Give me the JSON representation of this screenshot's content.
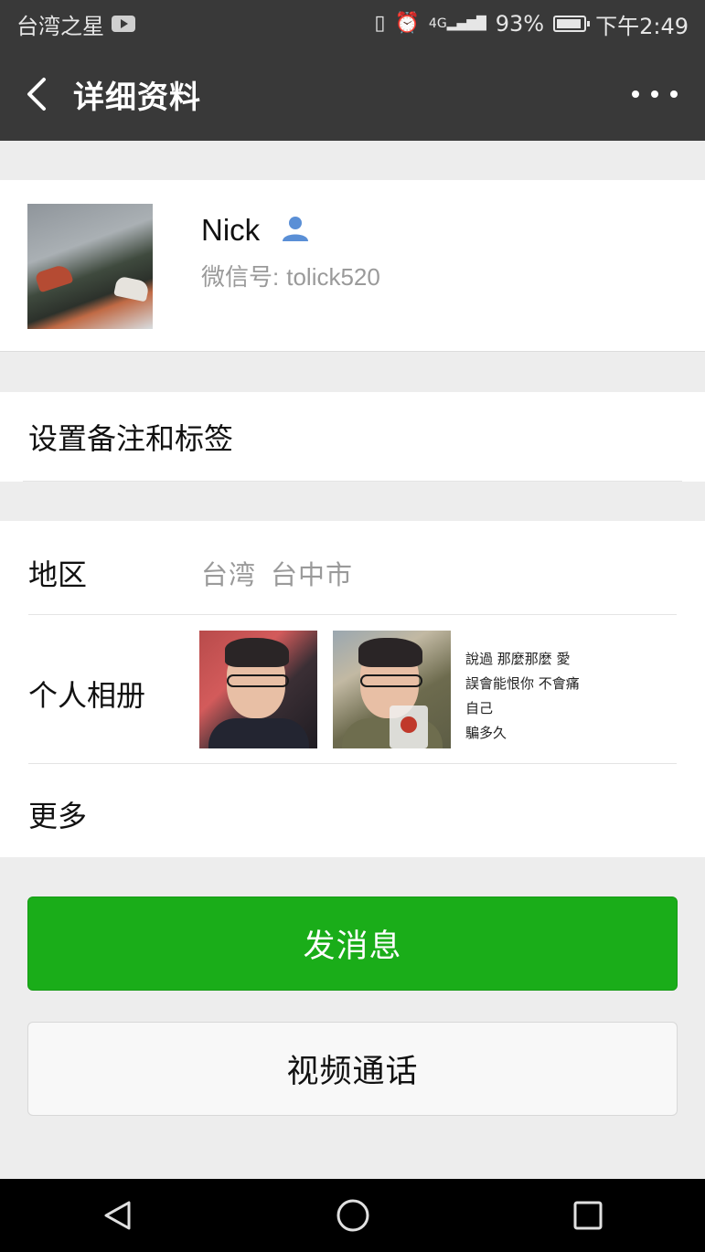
{
  "status_bar": {
    "carrier": "台湾之星",
    "network": "4G",
    "battery": "93%",
    "battery_level": 0.93,
    "time": "下午2:49"
  },
  "nav": {
    "title": "详细资料"
  },
  "profile": {
    "name": "Nick",
    "wechat_id_label": "微信号:",
    "wechat_id": "tolick520"
  },
  "remark": {
    "label": "设置备注和标签"
  },
  "region": {
    "label": "地区",
    "province": "台湾",
    "city": "台中市"
  },
  "album": {
    "label": "个人相册",
    "text_post_lines": [
      "說過  那麼那麼  愛",
      "誤會能恨你  不會痛",
      "自己",
      "騙多久"
    ]
  },
  "more": {
    "label": "更多"
  },
  "actions": {
    "send_message": "发消息",
    "video_call": "视频通话"
  },
  "colors": {
    "header_bg": "#393939",
    "primary_green": "#1aad19",
    "page_bg": "#ededed"
  }
}
